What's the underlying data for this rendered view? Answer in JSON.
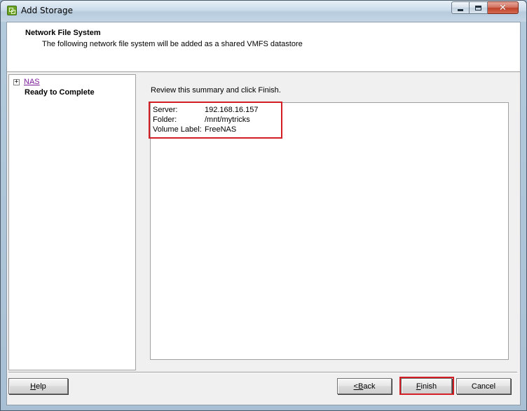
{
  "window": {
    "title": "Add Storage",
    "controls": {
      "minimize_icon": "minimize-icon",
      "maximize_icon": "maximize-icon",
      "close_icon": "close-icon",
      "close_glyph": "✕"
    }
  },
  "header": {
    "title": "Network File System",
    "subtitle": "The following network file system will be added as a shared VMFS datastore"
  },
  "steps": {
    "expander_glyph": "+",
    "items": [
      {
        "label": "NAS",
        "state": "link"
      },
      {
        "label": "Ready to Complete",
        "state": "current"
      }
    ]
  },
  "main": {
    "review_text": "Review this summary and click Finish.",
    "summary": [
      {
        "key": "Server:",
        "value": "192.168.16.157"
      },
      {
        "key": "Folder:",
        "value": "/mnt/mytricks"
      },
      {
        "key": "Volume Label:",
        "value": "FreeNAS"
      }
    ]
  },
  "buttons": {
    "help": {
      "mnemonic": "H",
      "rest": "elp"
    },
    "back": {
      "prefix": "< ",
      "mnemonic": "B",
      "rest": "ack"
    },
    "finish": {
      "mnemonic": "F",
      "rest": "inish"
    },
    "cancel": {
      "label": "Cancel"
    }
  },
  "colors": {
    "highlight": "#d21f25",
    "link": "#7a1b99"
  }
}
